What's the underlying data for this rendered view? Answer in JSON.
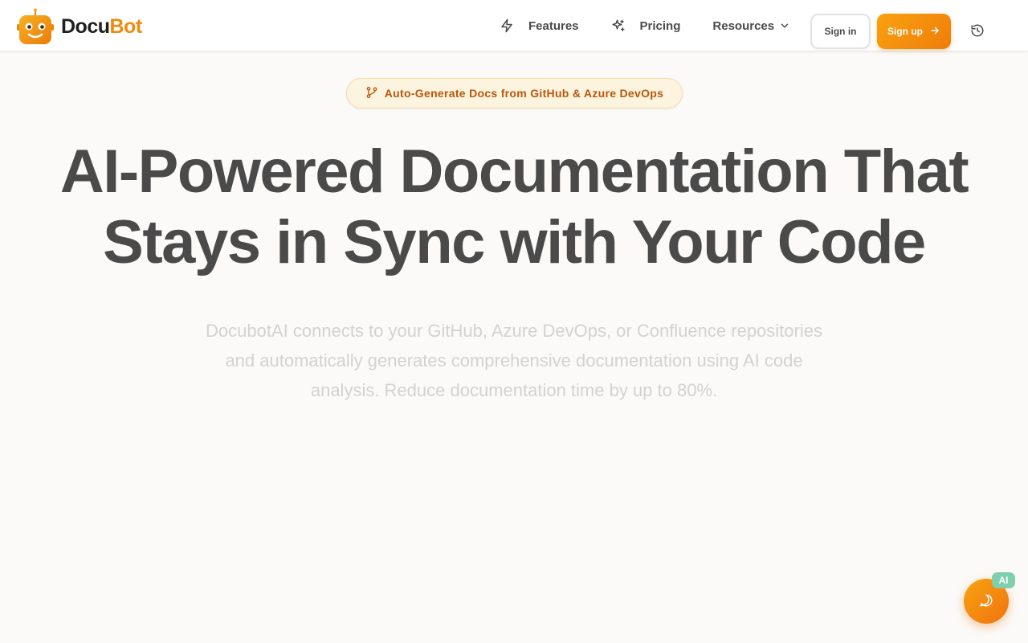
{
  "brand": {
    "name_part1": "Docu",
    "name_part2": "Bot",
    "logo_icon": "robot-icon",
    "accent_color": "#f08a0c"
  },
  "nav": {
    "items": [
      {
        "label": "Features",
        "icon": "lightning-icon"
      },
      {
        "label": "Pricing",
        "icon": "sparkles-icon"
      },
      {
        "label": "Resources",
        "icon": "chevron-down-icon"
      }
    ],
    "signin_label": "Sign in",
    "signup_label": "Sign up",
    "history_icon": "history-icon"
  },
  "hero": {
    "badge_text": "Auto-Generate Docs from GitHub & Azure DevOps",
    "badge_icon": "git-branch-icon",
    "headline_line1": "AI-Powered Documentation That",
    "headline_line2": "Stays in Sync with Your Code",
    "subtext_line1": "DocubotAI connects to your GitHub, Azure DevOps, or Confluence repositories",
    "subtext_line2": "and automatically generates comprehensive documentation using AI code",
    "subtext_line3": "analysis. Reduce documentation time by up to 80%."
  },
  "chat": {
    "badge_label": "AI",
    "icon": "chat-bubble-icon",
    "color": "#ef7d0a",
    "badge_color": "#7fcfae"
  }
}
